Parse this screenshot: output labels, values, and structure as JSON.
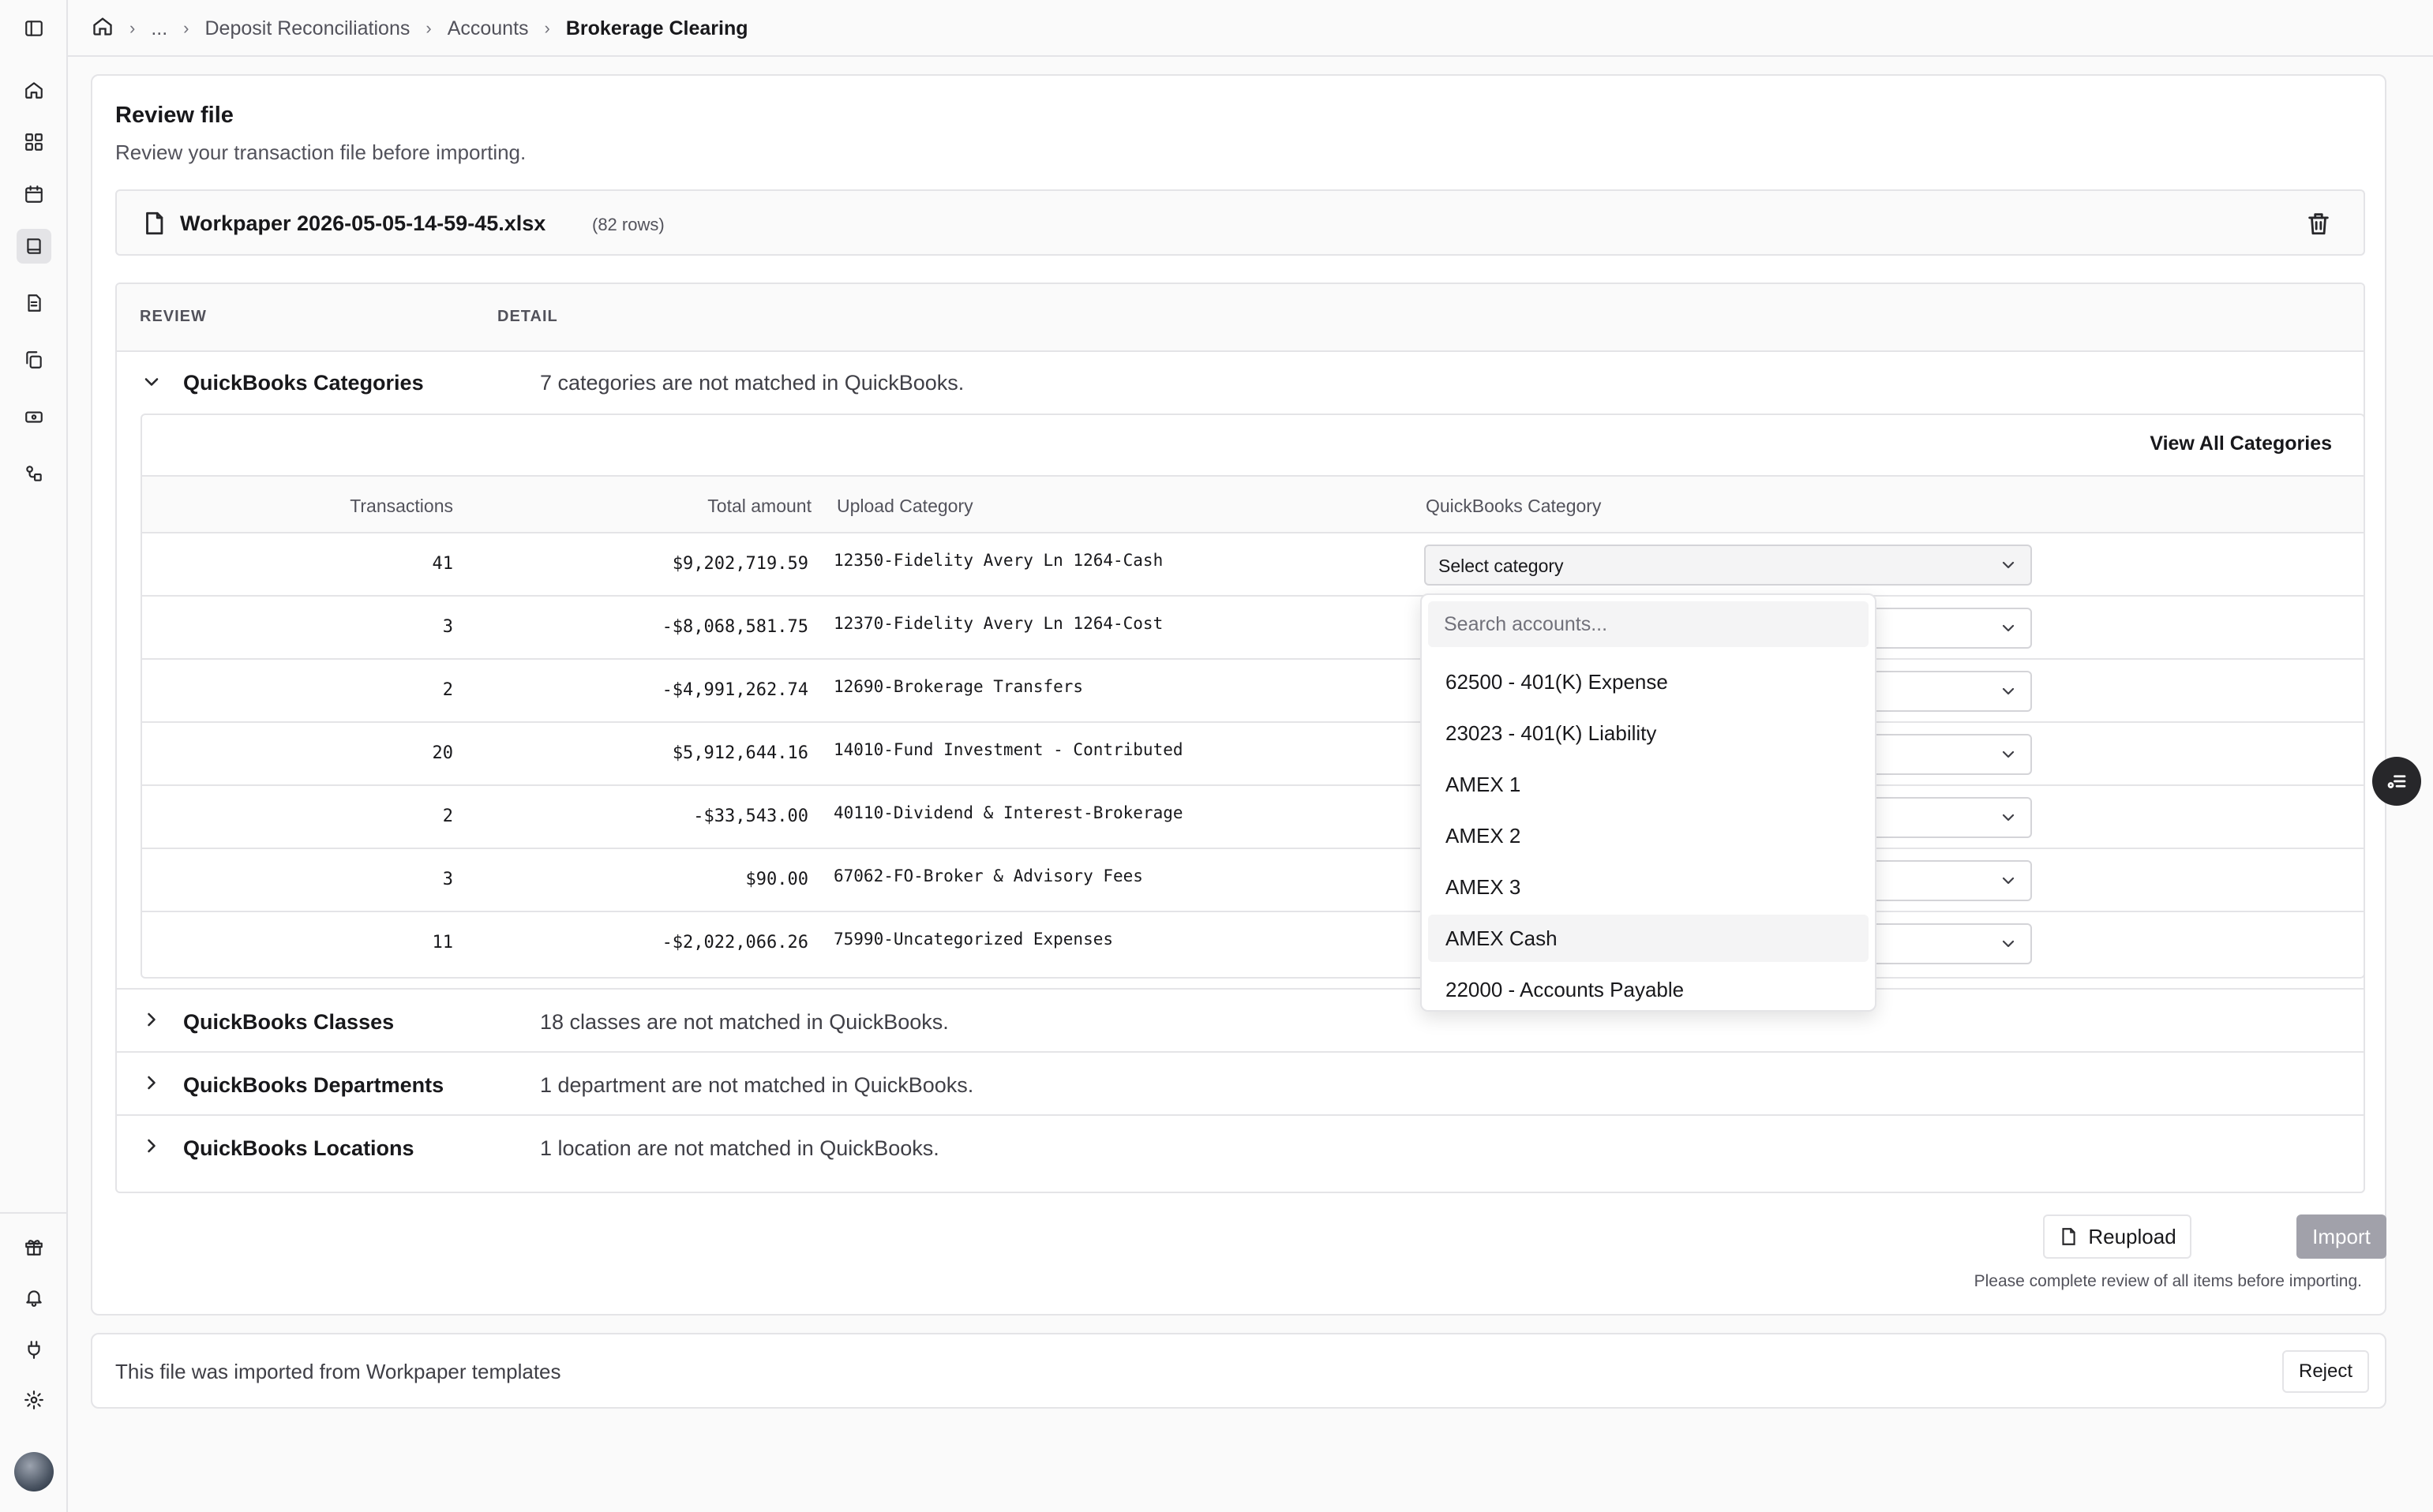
{
  "breadcrumb": {
    "home_icon": "home-icon",
    "ellipsis": "...",
    "items": [
      "Deposit Reconciliations",
      "Accounts",
      "Brokerage Clearing"
    ]
  },
  "sidebar": {
    "top_icons": [
      "panel-left-icon",
      "home-icon",
      "dashboard-icon",
      "calendar-icon",
      "book-icon",
      "file-text-icon",
      "copy-icon",
      "banknote-icon",
      "workflow-icon"
    ],
    "bottom_icons": [
      "gift-icon",
      "bell-icon",
      "plug-icon",
      "settings-icon"
    ]
  },
  "review_card": {
    "title": "Review file",
    "subtitle": "Review your transaction file before importing.",
    "file_name": "Workpaper 2026-05-05-14-59-45.xlsx",
    "row_count": "(82 rows)"
  },
  "review_table": {
    "col_review": "REVIEW",
    "col_detail": "DETAIL",
    "sections": [
      {
        "title": "QuickBooks Categories",
        "detail": "7 categories are not matched in QuickBooks.",
        "expanded": true
      },
      {
        "title": "QuickBooks Classes",
        "detail": "18 classes are not matched in QuickBooks.",
        "expanded": false
      },
      {
        "title": "QuickBooks Departments",
        "detail": "1 department are not matched in QuickBooks.",
        "expanded": false
      },
      {
        "title": "QuickBooks Locations",
        "detail": "1 location are not matched in QuickBooks.",
        "expanded": false
      }
    ]
  },
  "categories": {
    "view_all": "View All Categories",
    "headers": {
      "transactions": "Transactions",
      "total": "Total amount",
      "upload": "Upload Category",
      "qb": "QuickBooks Category"
    },
    "select_placeholder": "Select category",
    "rows": [
      {
        "tx": "41",
        "amount": "$9,202,719.59",
        "category": "12350-Fidelity Avery Ln 1264-Cash"
      },
      {
        "tx": "3",
        "amount": "-$8,068,581.75",
        "category": "12370-Fidelity Avery Ln 1264-Cost"
      },
      {
        "tx": "2",
        "amount": "-$4,991,262.74",
        "category": "12690-Brokerage Transfers"
      },
      {
        "tx": "20",
        "amount": "$5,912,644.16",
        "category": "14010-Fund Investment - Contributed"
      },
      {
        "tx": "2",
        "amount": "-$33,543.00",
        "category": "40110-Dividend & Interest-Brokerage"
      },
      {
        "tx": "3",
        "amount": "$90.00",
        "category": "67062-FO-Broker & Advisory Fees"
      },
      {
        "tx": "11",
        "amount": "-$2,022,066.26",
        "category": "75990-Uncategorized Expenses"
      }
    ]
  },
  "dropdown": {
    "search_placeholder": "Search accounts...",
    "options": [
      "62500 - 401(K) Expense",
      "23023 - 401(K) Liability",
      "AMEX 1",
      "AMEX 2",
      "AMEX 3",
      "AMEX Cash",
      "22000 - Accounts Payable"
    ],
    "highlighted": "AMEX Cash"
  },
  "actions": {
    "reupload": "Reupload",
    "import": "Import",
    "note": "Please complete review of all items before importing."
  },
  "footer": {
    "text": "This file was imported from Workpaper templates",
    "reject": "Reject"
  }
}
